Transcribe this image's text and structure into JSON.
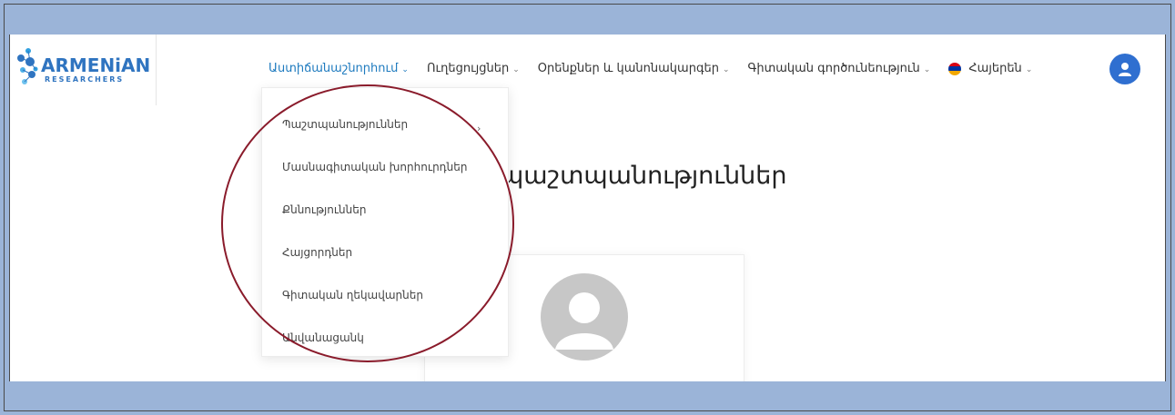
{
  "brand": {
    "logo_main": "ARMENiAN",
    "logo_sub": "RESEARCHERS"
  },
  "nav": {
    "items": [
      {
        "label": "Աստիճանաշնորհում",
        "active": true
      },
      {
        "label": "Ուղեցույցներ",
        "active": false
      },
      {
        "label": "Օրենքներ և կանոնակարգեր",
        "active": false
      },
      {
        "label": "Գիտական գործունեություն",
        "active": false
      }
    ],
    "language": "Հայերեն"
  },
  "dropdown": {
    "items": [
      "Պաշտպանություններ",
      "Մասնագիտական խորհուրդներ",
      "Քննություններ",
      "Հայցորդներ",
      "Գիտական ղեկավարներ",
      "Անվանացանկ"
    ]
  },
  "page": {
    "title": "պաշտպանություններ"
  },
  "colors": {
    "background": "#9bb4d8",
    "accent": "#1f7bbf",
    "highlight": "#8a1b2b",
    "user_button": "#2f6fd0"
  },
  "icons": {
    "user": "user-circle-icon",
    "chevron": "chevron-down-icon",
    "submenu": "chevron-right-icon",
    "flag": "armenia-flag-icon"
  }
}
